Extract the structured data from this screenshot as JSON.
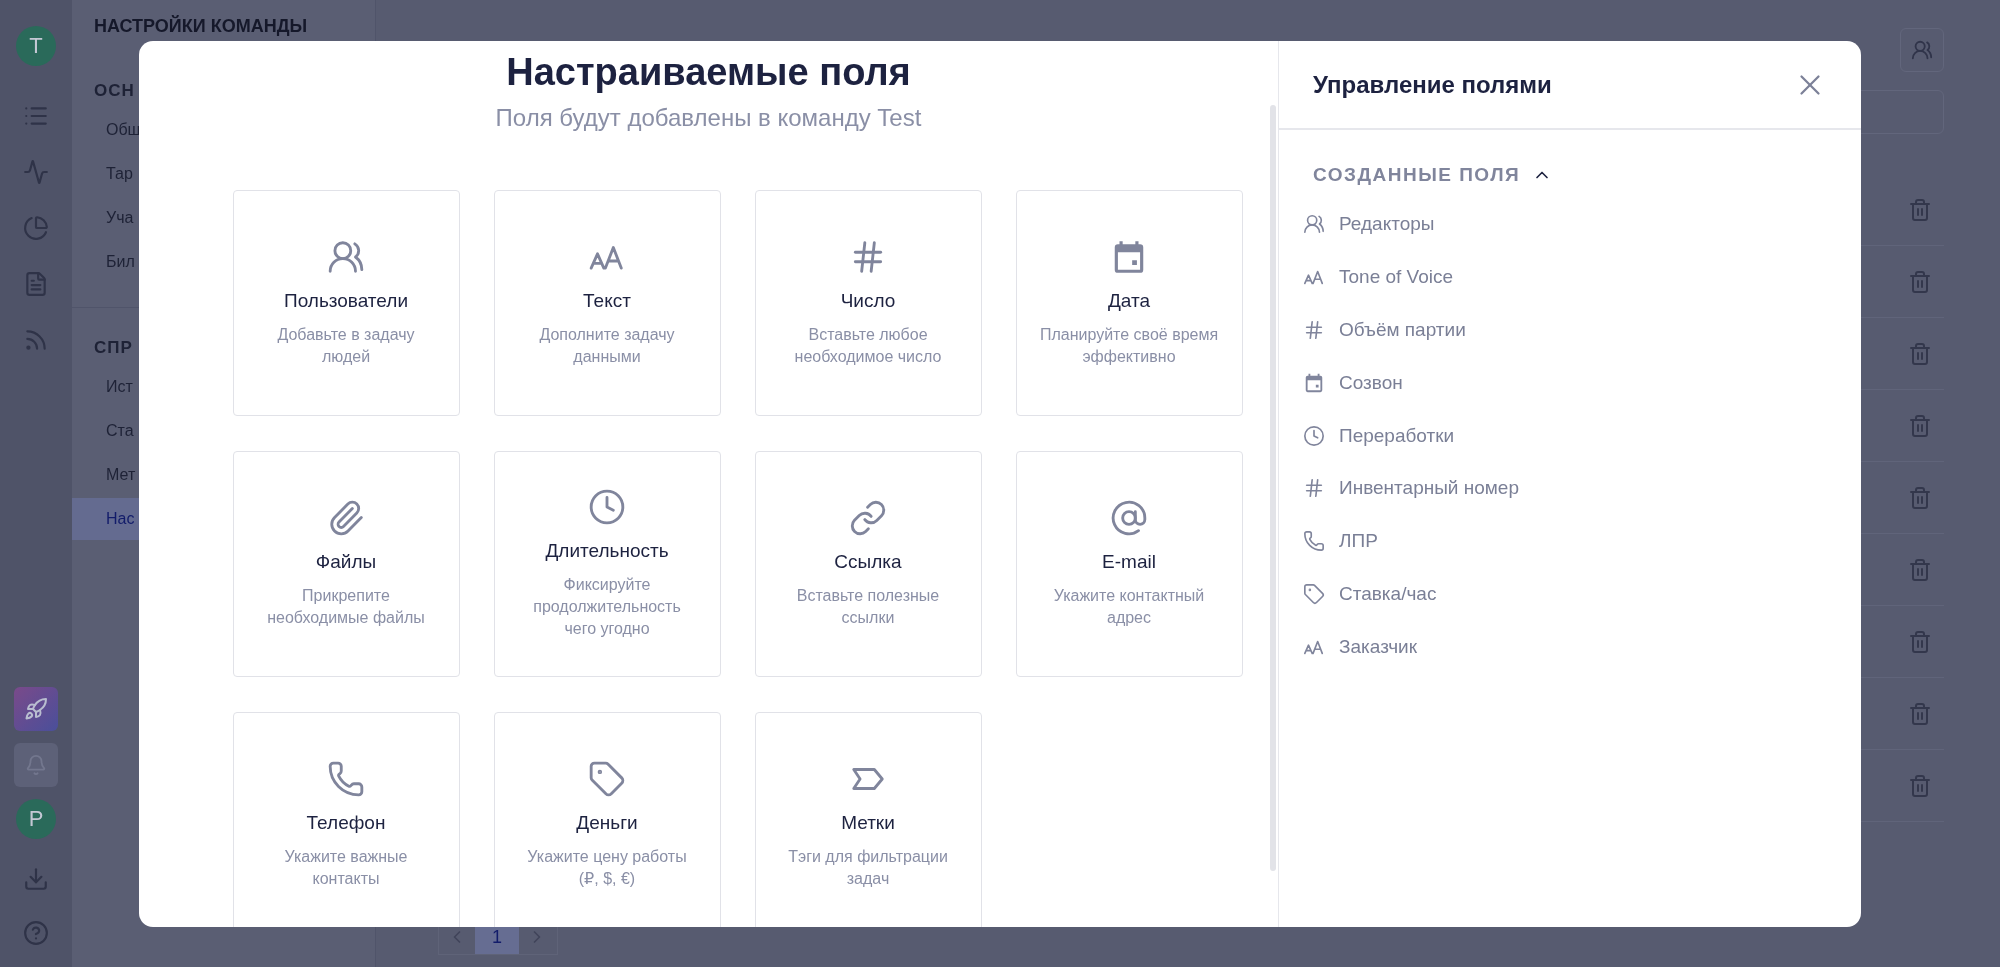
{
  "app_rail": {
    "team_avatar": "T",
    "user_avatar": "P"
  },
  "settings_sidebar": {
    "title": "НАСТРОЙКИ КОМАНДЫ",
    "sections": [
      {
        "heading": "ОСН",
        "items": [
          {
            "label": "Общ",
            "selected": false
          },
          {
            "label": "Тар",
            "selected": false
          },
          {
            "label": "Уча",
            "selected": false
          },
          {
            "label": "Бил",
            "selected": false
          }
        ]
      },
      {
        "heading": "СПР",
        "items": [
          {
            "label": "Ист",
            "selected": false
          },
          {
            "label": "Ста",
            "selected": false
          },
          {
            "label": "Мет",
            "selected": false
          },
          {
            "label": "Нас",
            "selected": true
          }
        ]
      }
    ]
  },
  "pagination": {
    "pages": [
      {
        "label": "1",
        "selected": true
      }
    ]
  },
  "modal": {
    "title": "Настраиваемые поля",
    "subtitle": "Поля будут добавлены в команду Test",
    "field_types": [
      {
        "kind": "users",
        "title": "Пользователи",
        "description": "Добавьте в задачу людей"
      },
      {
        "kind": "text",
        "title": "Текст",
        "description": "Дополните задачу данными"
      },
      {
        "kind": "number",
        "title": "Число",
        "description": "Вставьте любое необходимое число"
      },
      {
        "kind": "date",
        "title": "Дата",
        "description": "Планируйте своё время эффективно"
      },
      {
        "kind": "files",
        "title": "Файлы",
        "description": "Прикрепите необходимые файлы"
      },
      {
        "kind": "duration",
        "title": "Длительность",
        "description": "Фиксируйте продолжительность чего угодно"
      },
      {
        "kind": "link",
        "title": "Ссылка",
        "description": "Вставьте полезные ссылки"
      },
      {
        "kind": "email",
        "title": "E-mail",
        "description": "Укажите контактный адрес"
      },
      {
        "kind": "phone",
        "title": "Телефон",
        "description": "Укажите важные контакты"
      },
      {
        "kind": "money",
        "title": "Деньги",
        "description": "Укажите цену работы (₽, $, €)"
      },
      {
        "kind": "tags",
        "title": "Метки",
        "description": "Тэги для фильтрации задач"
      }
    ],
    "panel": {
      "title": "Управление полями",
      "section": {
        "heading": "СОЗДАННЫЕ ПОЛЯ",
        "expanded": true,
        "fields": [
          {
            "kind": "users",
            "label": "Редакторы"
          },
          {
            "kind": "text",
            "label": "Tone of Voice"
          },
          {
            "kind": "number",
            "label": "Объём партии"
          },
          {
            "kind": "date",
            "label": "Созвон"
          },
          {
            "kind": "duration",
            "label": "Переработки"
          },
          {
            "kind": "number",
            "label": "Инвентарный номер"
          },
          {
            "kind": "phone",
            "label": "ЛПР"
          },
          {
            "kind": "money",
            "label": "Ставка/час"
          },
          {
            "kind": "text",
            "label": "Заказчик"
          }
        ]
      }
    }
  }
}
